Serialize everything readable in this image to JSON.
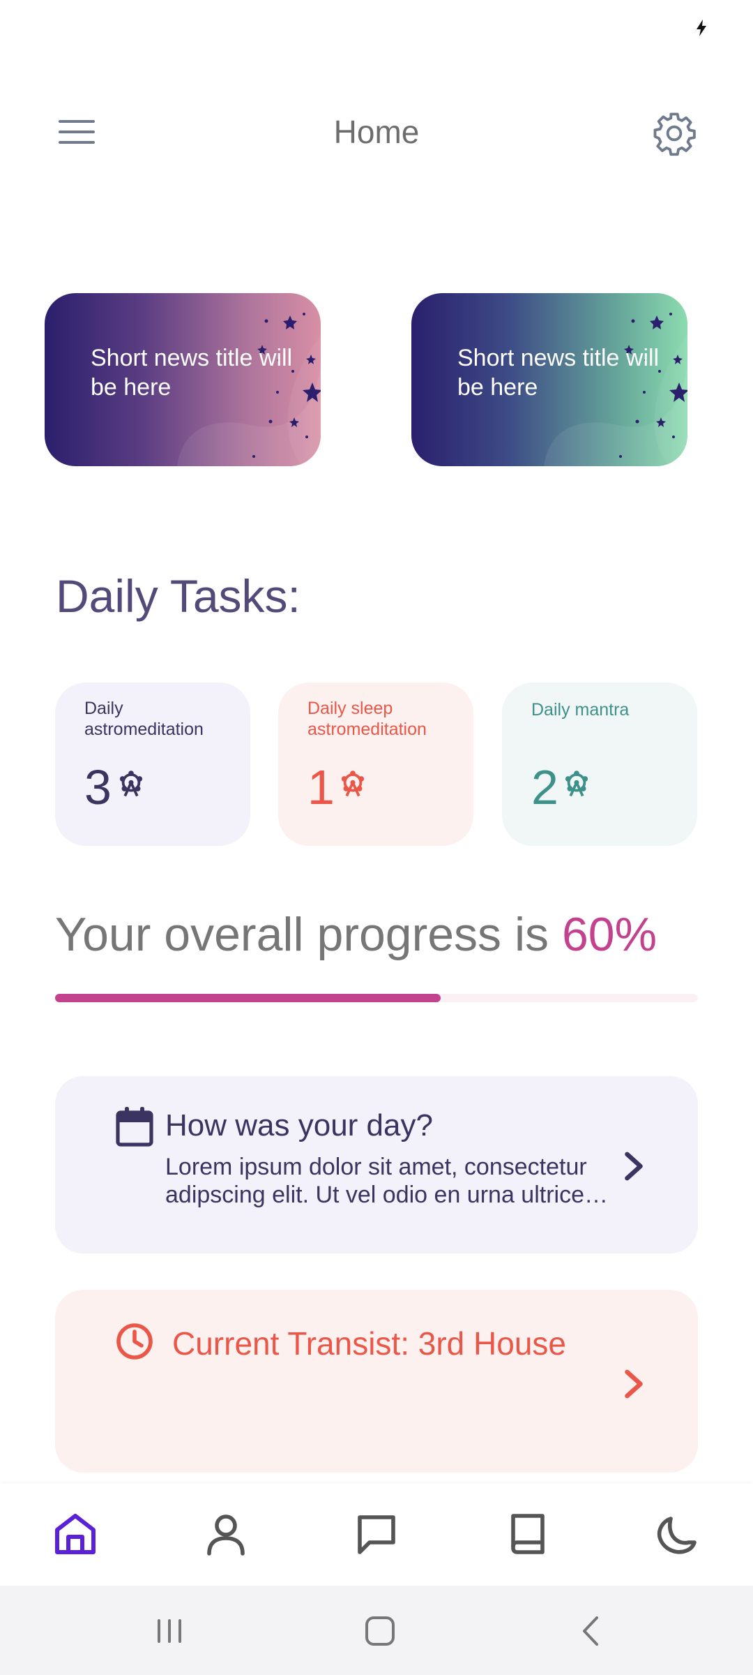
{
  "status_bar": {
    "charging_icon": "bolt-icon"
  },
  "header": {
    "title": "Home",
    "menu_icon": "hamburger-menu-icon",
    "settings_icon": "gear-icon"
  },
  "news": [
    {
      "title": "Short news title will be here",
      "gradient": [
        "#2b1f6d",
        "#d88fa5"
      ]
    },
    {
      "title": "Short news title will be here",
      "gradient": [
        "#2b1f6d",
        "#8cdbb0"
      ]
    }
  ],
  "daily_tasks": {
    "heading": "Daily Tasks:",
    "items": [
      {
        "label": "Daily astromeditation",
        "count": "3",
        "icon": "ferris-wheel-icon",
        "color": "#3b3360"
      },
      {
        "label": "Daily sleep astromeditation",
        "count": "1",
        "icon": "ferris-wheel-icon",
        "color": "#ea5748"
      },
      {
        "label": "Daily mantra",
        "count": "2",
        "icon": "ferris-wheel-icon",
        "color": "#3e918a"
      }
    ]
  },
  "progress": {
    "label": "Your overall progress is",
    "value_text": "60%",
    "value": 0.6,
    "color": "#c2428e"
  },
  "journal": {
    "title": "How was your day?",
    "text": "Lorem ipsum dolor sit amet, consectetur adipscing elit. Ut vel odio en urna ultrice…",
    "icon": "calendar-icon"
  },
  "transit": {
    "title": "Current Transist: 3rd House",
    "icon": "clock-icon"
  },
  "bottom_nav": {
    "items": [
      {
        "name": "home",
        "icon": "home-icon",
        "active": true
      },
      {
        "name": "profile",
        "icon": "user-icon",
        "active": false
      },
      {
        "name": "chat",
        "icon": "chat-bubble-icon",
        "active": false
      },
      {
        "name": "library",
        "icon": "book-icon",
        "active": false
      },
      {
        "name": "night",
        "icon": "moon-icon",
        "active": false
      }
    ],
    "active_color": "#5b21d8",
    "inactive_color": "#555555"
  },
  "system_nav": {
    "icons": [
      "recent-apps-icon",
      "home-circle-icon",
      "back-icon"
    ]
  }
}
